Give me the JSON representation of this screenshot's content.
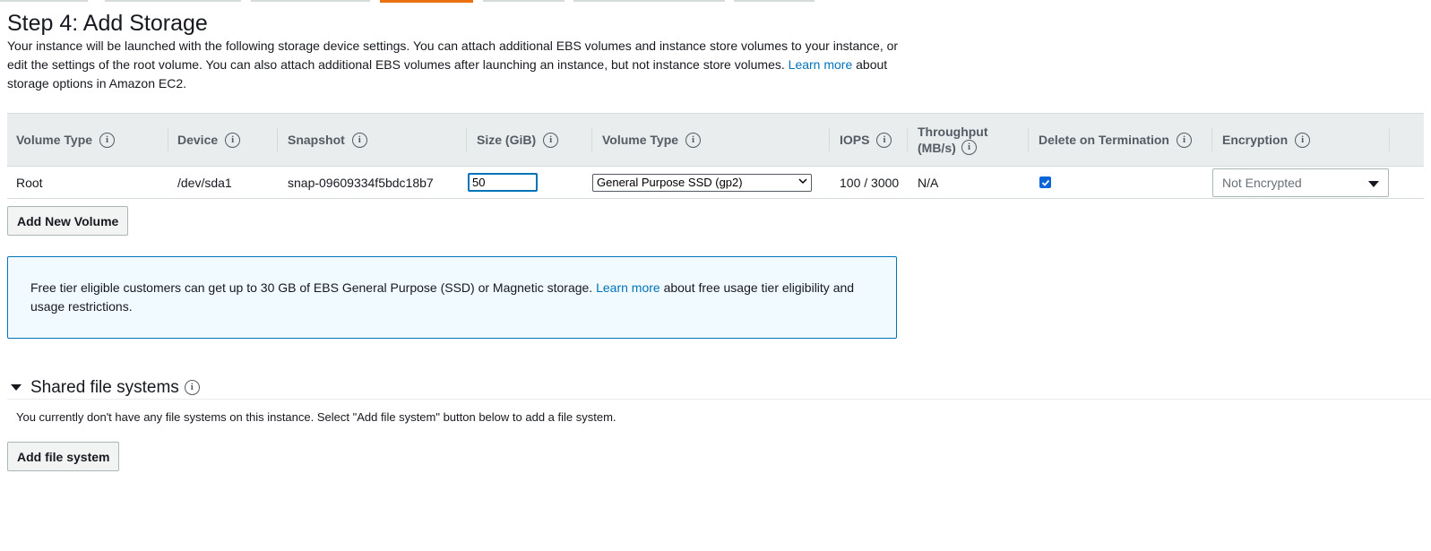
{
  "page": {
    "title": "Step 4: Add Storage",
    "intro_text": "Your instance will be launched with the following storage device settings. You can attach additional EBS volumes and instance store volumes to your instance, or edit the settings of the root volume. You can also attach additional EBS volumes after launching an instance, but not instance store volumes.",
    "intro_link": "Learn more",
    "intro_suffix": "about storage options in Amazon EC2."
  },
  "table": {
    "headers": {
      "volume_type": "Volume Type",
      "device": "Device",
      "snapshot": "Snapshot",
      "size": "Size (GiB)",
      "ebs_volume_type": "Volume Type",
      "iops": "IOPS",
      "throughput": "Throughput (MB/s)",
      "delete_on_termination": "Delete on Termination",
      "encryption": "Encryption"
    },
    "row": {
      "volume_type": "Root",
      "device": "/dev/sda1",
      "snapshot": "snap-09609334f5bdc18b7",
      "size": "50",
      "ebs_volume_type": "General Purpose SSD (gp2)",
      "iops": "100 / 3000",
      "throughput": "N/A",
      "delete_on_termination": true,
      "encryption": "Not Encrypted"
    }
  },
  "buttons": {
    "add_volume": "Add New Volume",
    "add_file_system": "Add file system"
  },
  "notice": {
    "text": "Free tier eligible customers can get up to 30 GB of EBS General Purpose (SSD) or Magnetic storage.",
    "link": "Learn more",
    "suffix": "about free usage tier eligibility and usage restrictions."
  },
  "shared_fs": {
    "title": "Shared file systems",
    "description": "You currently don't have any file systems on this instance. Select \"Add file system\" button below to add a file system."
  },
  "icons": {
    "info": "info-icon",
    "collapse": "caret-down-icon",
    "dropdown": "caret-down-icon",
    "checkbox": "check-icon"
  },
  "colors": {
    "accent": "#ec7211",
    "link": "#0073bb",
    "notice_bg": "#f1faff",
    "checkbox": "#0a66d8"
  }
}
